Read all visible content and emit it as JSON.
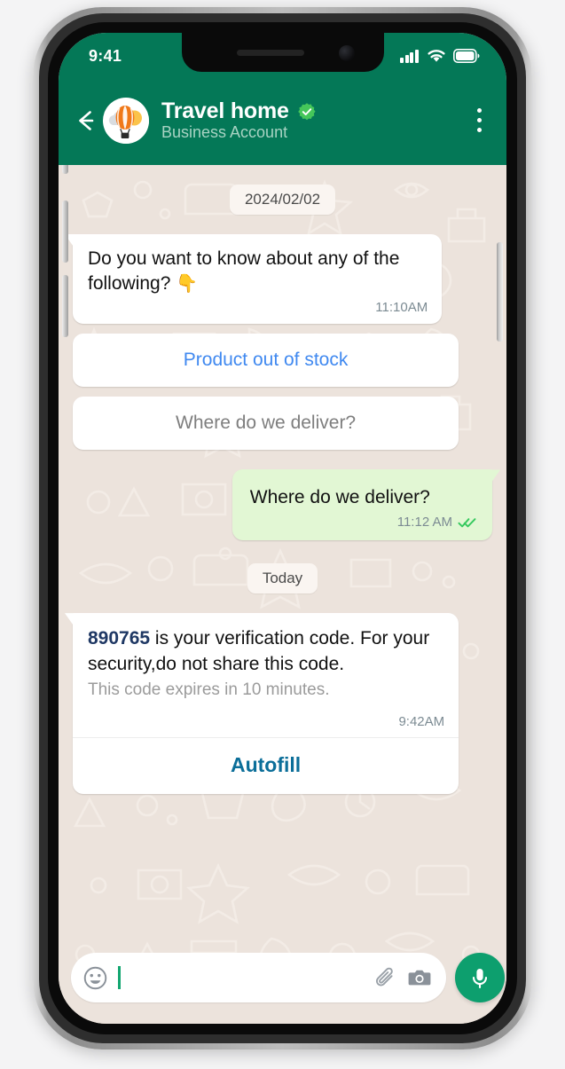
{
  "status_bar": {
    "time": "9:41",
    "signal_icon": "cellular-signal-icon",
    "wifi_icon": "wifi-icon",
    "battery_icon": "battery-icon"
  },
  "header": {
    "back_icon": "back-arrow-icon",
    "avatar_icon": "hot-air-balloon-avatar",
    "title": "Travel home",
    "verified_icon": "verified-badge-icon",
    "subtitle": "Business Account",
    "menu_icon": "overflow-menu-icon"
  },
  "chat": {
    "date_chip_1": "2024/02/02",
    "date_chip_2": "Today",
    "messages": [
      {
        "direction": "in",
        "text": "Do you want to know about any of the following? ",
        "emoji": "👇",
        "time": "11:10AM"
      },
      {
        "direction": "out",
        "text": "Where do we deliver?",
        "time": "11:12 AM",
        "status_icon": "double-check-read-icon"
      }
    ],
    "options": [
      {
        "label": "Product out of stock",
        "style": "blue"
      },
      {
        "label": "Where do we deliver?",
        "style": "gray"
      }
    ],
    "verification_card": {
      "code": "890765",
      "main_text": " is your verification code. For your security,do not share this code.",
      "sub_text": "This code expires in 10 minutes.",
      "time": "9:42AM",
      "action_label": "Autofill"
    }
  },
  "composer": {
    "emoji_icon": "emoji-smiley-icon",
    "placeholder": "",
    "value": "",
    "attach_icon": "paperclip-icon",
    "camera_icon": "camera-icon",
    "mic_icon": "microphone-icon"
  },
  "colors": {
    "header_green": "#047857",
    "outgoing_bubble": "#E2F7D4",
    "chat_background": "#ECE3DC",
    "link_blue": "#4089F0",
    "autofill_blue": "#0B6E99",
    "code_navy": "#1F3864",
    "mic_green": "#0D9F6E"
  }
}
